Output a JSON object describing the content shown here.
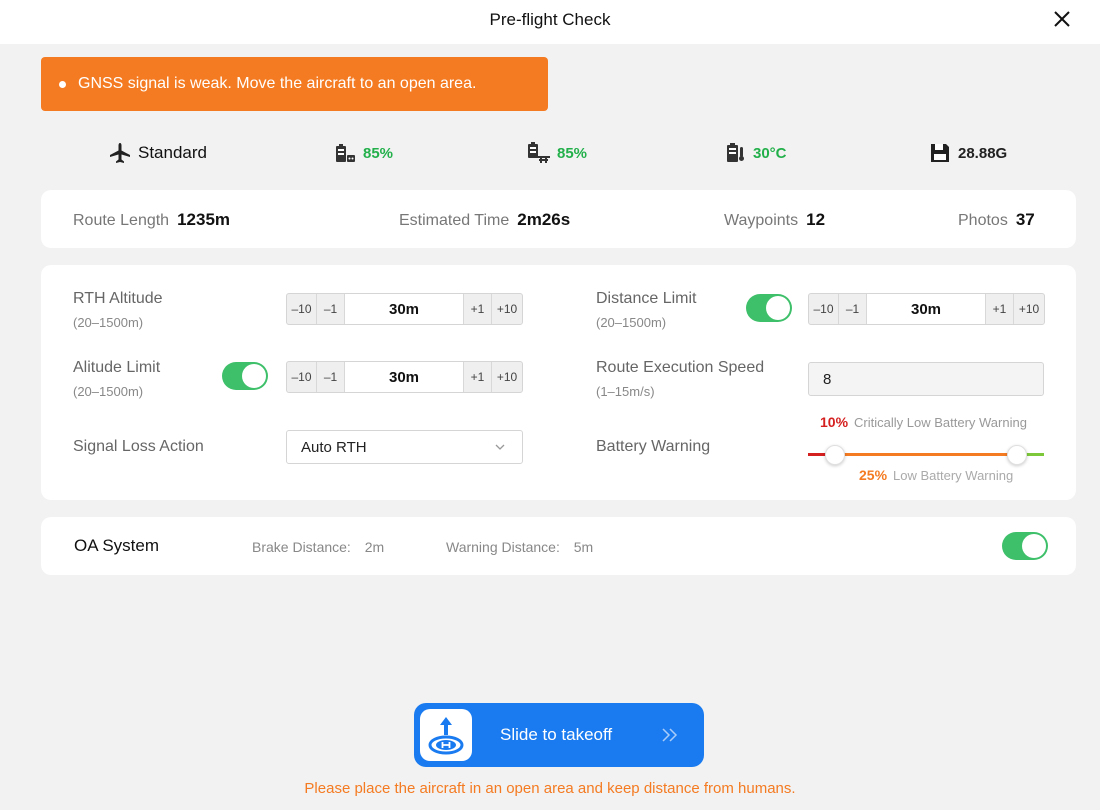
{
  "header": {
    "title": "Pre-flight Check"
  },
  "alert": {
    "text": "GNSS signal is weak. Move the aircraft to an open area."
  },
  "status": {
    "mode": "Standard",
    "rc_battery": "85%",
    "aircraft_battery": "85%",
    "battery_temp": "30°C",
    "storage": "28.88G"
  },
  "route": {
    "length_label": "Route Length",
    "length_value": "1235m",
    "time_label": "Estimated Time",
    "time_value": "2m26s",
    "waypoints_label": "Waypoints",
    "waypoints_value": "12",
    "photos_label": "Photos",
    "photos_value": "37"
  },
  "params": {
    "rth_altitude": {
      "label": "RTH Altitude",
      "range": "(20–1500m)",
      "value": "30m"
    },
    "altitude_limit": {
      "label": "Alitude Limit",
      "range": "(20–1500m)",
      "value": "30m",
      "enabled": true
    },
    "distance_limit": {
      "label": "Distance Limit",
      "range": "(20–1500m)",
      "value": "30m",
      "enabled": true
    },
    "route_speed": {
      "label": "Route Execution Speed",
      "range": "(1–15m/s)",
      "value": "8"
    },
    "signal_loss": {
      "label": "Signal Loss Action",
      "value": "Auto RTH"
    },
    "battery_warning": {
      "label": "Battery Warning",
      "critical_pct": "10%",
      "critical_label": "Critically Low Battery Warning",
      "low_pct": "25%",
      "low_label": "Low Battery Warning"
    },
    "stepper": {
      "minus10": "–10",
      "minus1": "–1",
      "plus1": "+1",
      "plus10": "+10"
    }
  },
  "oa": {
    "title": "OA System",
    "brake_label": "Brake Distance: ",
    "brake_value": "2m",
    "warning_label": "Warning Distance: ",
    "warning_value": "5m",
    "enabled": true
  },
  "takeoff": {
    "label": "Slide to takeoff",
    "note": "Please place the aircraft in an open area and keep distance from humans."
  },
  "colors": {
    "accent": "#1a7bf0",
    "warning": "#f47b22",
    "ok": "#23b04b",
    "critical": "#d52020",
    "toggle_on": "#3ec06a"
  }
}
